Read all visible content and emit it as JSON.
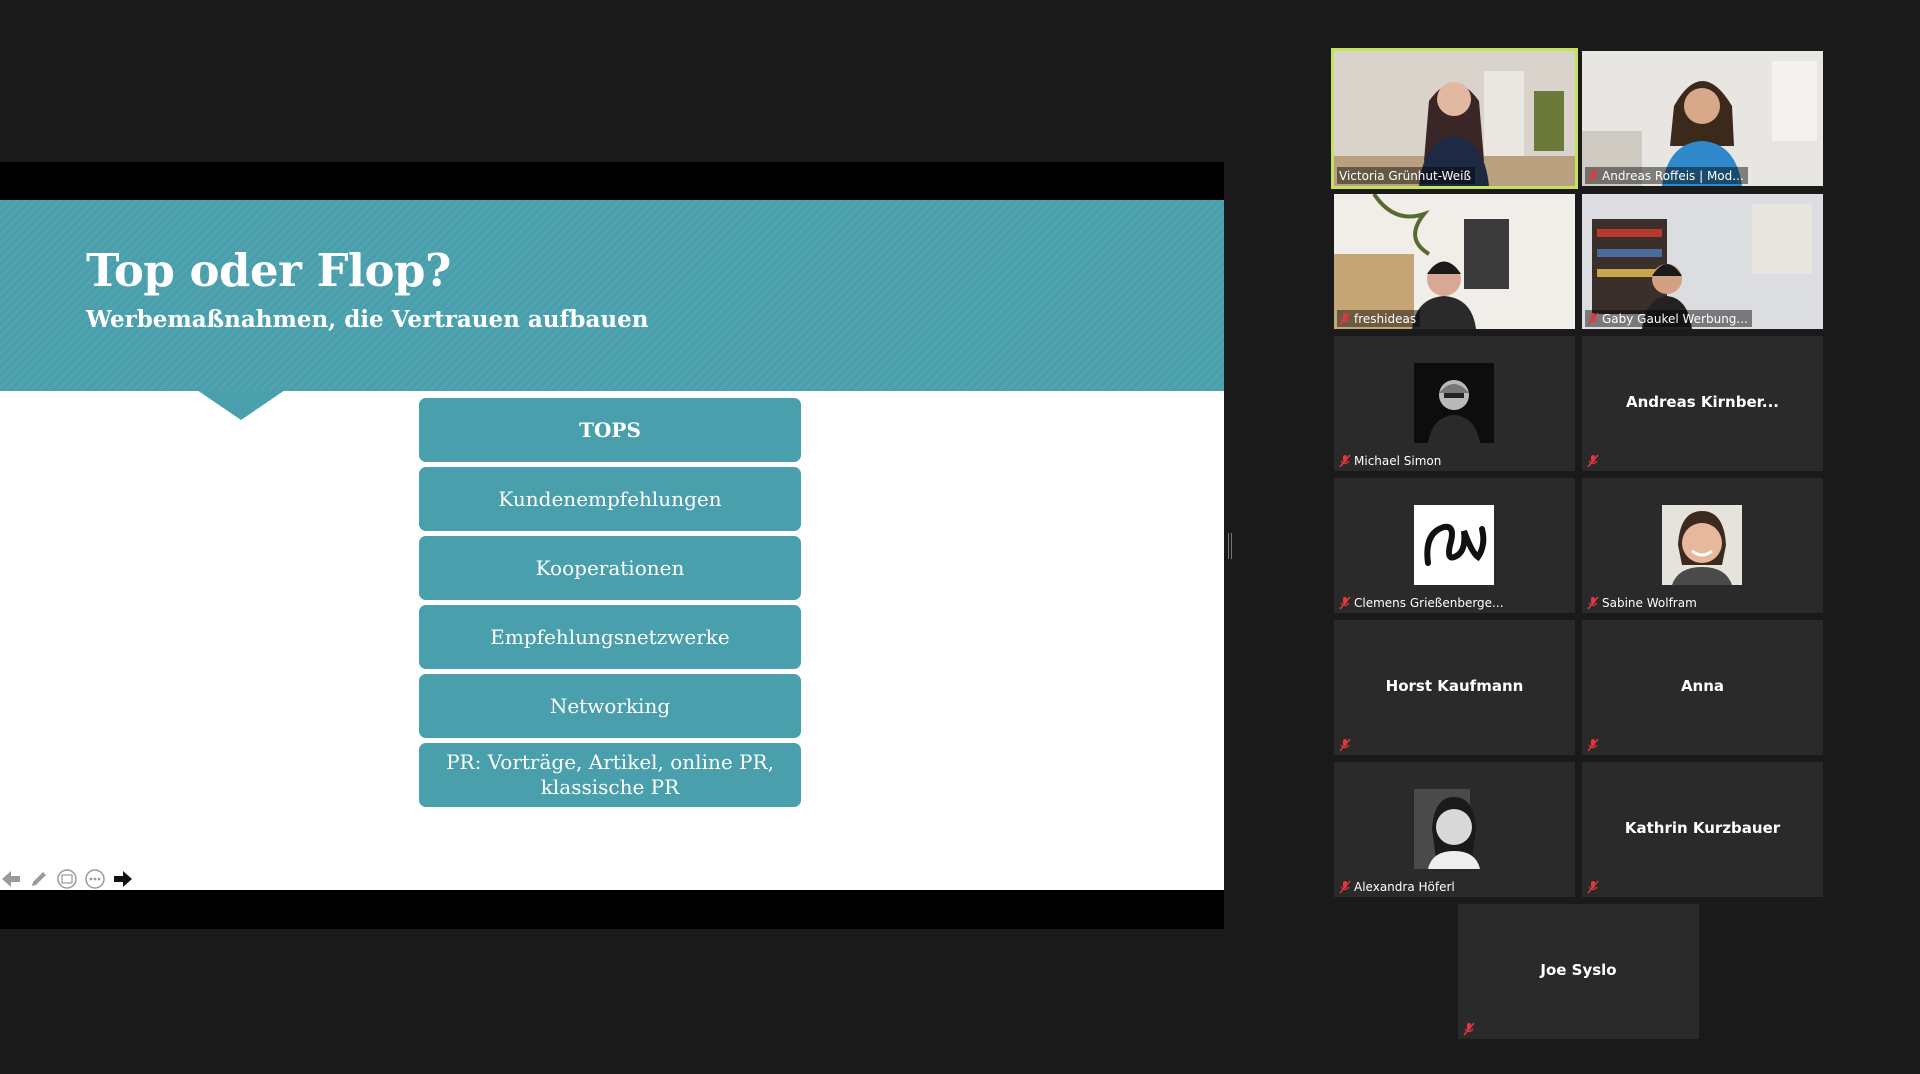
{
  "slide": {
    "title": "Top oder Flop?",
    "subtitle": "Werbemaßnahmen, die Vertrauen aufbauen",
    "boxes": [
      "TOPS",
      "Kundenempfehlungen",
      "Kooperationen",
      "Empfehlungsnetzwerke",
      "Networking",
      "PR: Vorträge, Artikel, online PR, klassische PR"
    ],
    "toolbar": [
      "previous-icon",
      "pen-icon",
      "slides-icon",
      "more-icon",
      "next-icon"
    ]
  },
  "participants": [
    {
      "name": "Victoria Grünhut-Weiß",
      "kind": "video",
      "active": true
    },
    {
      "name": "Andreas Roffeis | Mod...",
      "kind": "video"
    },
    {
      "name": "freshideas",
      "kind": "video"
    },
    {
      "name": "Gaby Gaukel Werbung...",
      "kind": "video"
    },
    {
      "name": "Michael Simon",
      "kind": "avatar"
    },
    {
      "name": "Andreas  Kirnber...",
      "kind": "text"
    },
    {
      "name": "Clemens Grießenberge...",
      "kind": "avatar"
    },
    {
      "name": "Sabine Wolfram",
      "kind": "avatar"
    },
    {
      "name": "Horst Kaufmann",
      "kind": "text"
    },
    {
      "name": "Anna",
      "kind": "text"
    },
    {
      "name": "Alexandra Höferl",
      "kind": "avatar"
    },
    {
      "name": "Kathrin Kurzbauer",
      "kind": "text"
    },
    {
      "name": "Joe Syslo",
      "kind": "text"
    }
  ],
  "colors": {
    "slide_accent": "#4a9fac",
    "active_speaker_border": "#c5e35a",
    "muted_mic": "#e0383e",
    "background": "#1a1a1a"
  }
}
